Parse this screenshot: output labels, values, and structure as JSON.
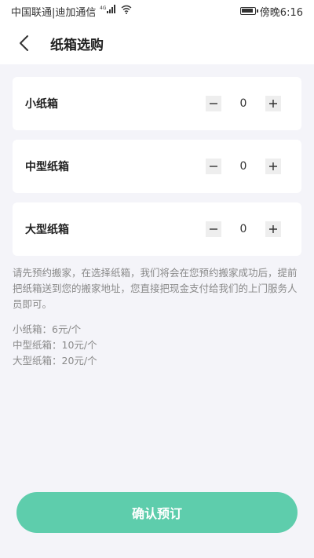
{
  "status_bar": {
    "carrier": "中国联通|迪加通信",
    "signal_tag": "4G",
    "time_label": "傍晚6:16"
  },
  "header": {
    "title": "纸箱选购"
  },
  "boxes": [
    {
      "label": "小纸箱",
      "quantity": "0"
    },
    {
      "label": "中型纸箱",
      "quantity": "0"
    },
    {
      "label": "大型纸箱",
      "quantity": "0"
    }
  ],
  "notice": "请先预约搬家，在选择纸箱，我们将会在您预约搬家成功后，提前把纸箱送到您的搬家地址，您直接把现金支付给我们的上门服务人员即可。",
  "prices": [
    "小纸箱：6元/个",
    "中型纸箱：10元/个",
    "大型纸箱：20元/个"
  ],
  "confirm_label": "确认预订",
  "colors": {
    "accent": "#5ecdac",
    "background": "#f4f4f9"
  }
}
